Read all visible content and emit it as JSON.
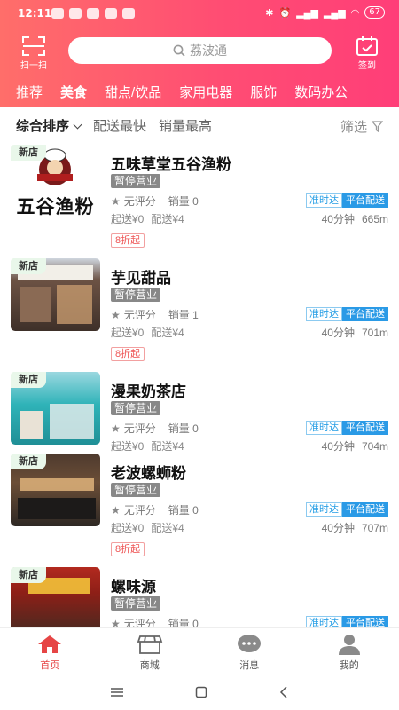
{
  "status_bar": {
    "time": "12:11",
    "battery": "67"
  },
  "header": {
    "scan_label": "扫一扫",
    "search_placeholder": "荔波通",
    "signin_label": "签到"
  },
  "categories": [
    {
      "label": "推荐"
    },
    {
      "label": "美食"
    },
    {
      "label": "甜点/饮品"
    },
    {
      "label": "家用电器"
    },
    {
      "label": "服饰"
    },
    {
      "label": "数码办公"
    }
  ],
  "sort": {
    "default_label": "综合排序",
    "fastest_label": "配送最快",
    "sales_label": "销量最高",
    "filter_label": "筛选"
  },
  "stores": [
    {
      "new_tag": "新店",
      "name": "五味草堂五谷渔粉",
      "status": "暂停营业",
      "rating": "无评分",
      "sales": "销量 0",
      "badge_ontime": "准时达",
      "badge_platform": "平台配送",
      "min_order": "起送¥0",
      "delivery_fee": "配送¥4",
      "time": "40分钟",
      "distance": "665m",
      "discount": "8折起"
    },
    {
      "new_tag": "新店",
      "name": "芋见甜品",
      "status": "暂停营业",
      "rating": "无评分",
      "sales": "销量 1",
      "badge_ontime": "准时达",
      "badge_platform": "平台配送",
      "min_order": "起送¥0",
      "delivery_fee": "配送¥4",
      "time": "40分钟",
      "distance": "701m",
      "discount": "8折起"
    },
    {
      "new_tag": "新店",
      "name": "漫果奶茶店",
      "status": "暂停营业",
      "rating": "无评分",
      "sales": "销量 0",
      "badge_ontime": "准时达",
      "badge_platform": "平台配送",
      "min_order": "起送¥0",
      "delivery_fee": "配送¥4",
      "time": "40分钟",
      "distance": "704m",
      "discount": ""
    },
    {
      "new_tag": "新店",
      "name": "老波螺蛳粉",
      "status": "暂停营业",
      "rating": "无评分",
      "sales": "销量 0",
      "badge_ontime": "准时达",
      "badge_platform": "平台配送",
      "min_order": "起送¥0",
      "delivery_fee": "配送¥4",
      "time": "40分钟",
      "distance": "707m",
      "discount": "8折起"
    },
    {
      "new_tag": "新店",
      "name": "螺味源",
      "status": "暂停营业",
      "rating": "无评分",
      "sales": "销量 0",
      "badge_ontime": "准时达",
      "badge_platform": "平台配送",
      "min_order": "",
      "delivery_fee": "",
      "time": "",
      "distance": "",
      "discount": ""
    }
  ],
  "logo_text": "五谷渔粉",
  "bottom_nav": [
    {
      "label": "首页"
    },
    {
      "label": "商城"
    },
    {
      "label": "消息"
    },
    {
      "label": "我的"
    }
  ],
  "colors": {
    "accent": "#ff4d73",
    "active_nav": "#e64545",
    "badge_blue": "#2a9ae6"
  }
}
